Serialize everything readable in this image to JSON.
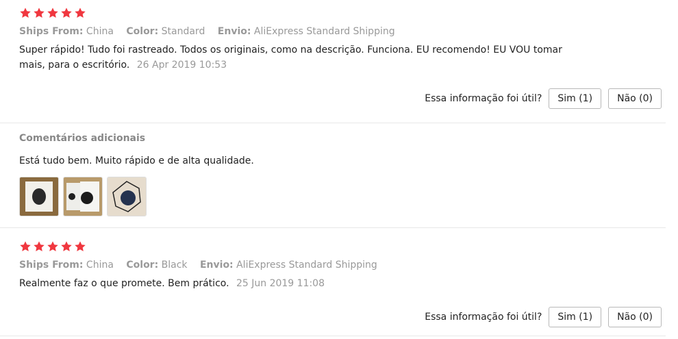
{
  "reviews": [
    {
      "stars": 5,
      "ships_from_key": "Ships From:",
      "ships_from": "China",
      "color_key": "Color:",
      "color": "Standard",
      "envio_key": "Envio:",
      "envio": "AliExpress Standard Shipping",
      "text": "Super rápido! Tudo foi rastreado. Todos os originais, como na descrição. Funciona. EU recomendo! EU VOU tomar mais, para o escritório.",
      "date": "26 Apr 2019 10:53",
      "helpful_question": "Essa informação foi útil?",
      "yes_label": "Sim (1)",
      "no_label": "Não (0)"
    },
    {
      "stars": 5,
      "ships_from_key": "Ships From:",
      "ships_from": "China",
      "color_key": "Color:",
      "color": "Black",
      "envio_key": "Envio:",
      "envio": "AliExpress Standard Shipping",
      "text": "Realmente faz o que promete. Bem prático.",
      "date": "25 Jun 2019 11:08",
      "helpful_question": "Essa informação foi útil?",
      "yes_label": "Sim (1)",
      "no_label": "Não (0)"
    }
  ],
  "additional": {
    "title": "Comentários adicionais",
    "text": "Está tudo bem. Muito rápido e de alta qualidade."
  },
  "colors": {
    "star": "#f0373f",
    "border": "#b8b8b8",
    "muted": "#999999"
  },
  "icons": [
    "star-icon"
  ]
}
